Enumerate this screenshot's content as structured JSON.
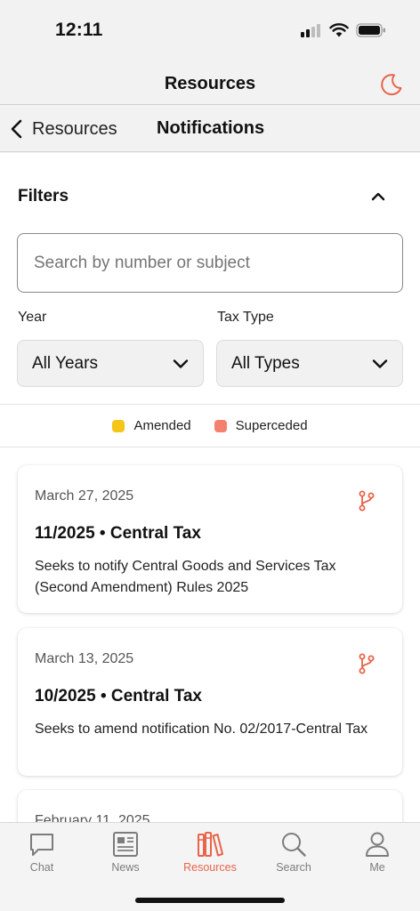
{
  "status_bar": {
    "time": "12:11"
  },
  "header": {
    "title": "Resources"
  },
  "sub_header": {
    "back_label": "Resources",
    "title": "Notifications"
  },
  "filters": {
    "title": "Filters",
    "search_placeholder": "Search by number or subject",
    "year": {
      "label": "Year",
      "value": "All Years"
    },
    "tax_type": {
      "label": "Tax Type",
      "value": "All Types"
    }
  },
  "legend": [
    {
      "label": "Amended",
      "color": "#f5c518"
    },
    {
      "label": "Superceded",
      "color": "#f4806e"
    }
  ],
  "notifications": [
    {
      "date": "March 27, 2025",
      "title": "11/2025 • Central Tax",
      "description": "Seeks to notify Central Goods and Services Tax (Second Amendment) Rules 2025"
    },
    {
      "date": "March 13, 2025",
      "title": "10/2025 • Central Tax",
      "description": "Seeks to amend notification No. 02/2017-Central Tax"
    },
    {
      "date": "February 11, 2025",
      "title": "",
      "description": ""
    }
  ],
  "tab_bar": {
    "tabs": [
      {
        "label": "Chat",
        "icon": "chat-bubble-icon"
      },
      {
        "label": "News",
        "icon": "newspaper-icon"
      },
      {
        "label": "Resources",
        "icon": "books-icon",
        "active": true
      },
      {
        "label": "Search",
        "icon": "magnifier-icon"
      },
      {
        "label": "Me",
        "icon": "person-icon"
      }
    ]
  },
  "colors": {
    "accent": "#e8644a",
    "amended": "#f5c518",
    "superceded": "#f4806e"
  }
}
